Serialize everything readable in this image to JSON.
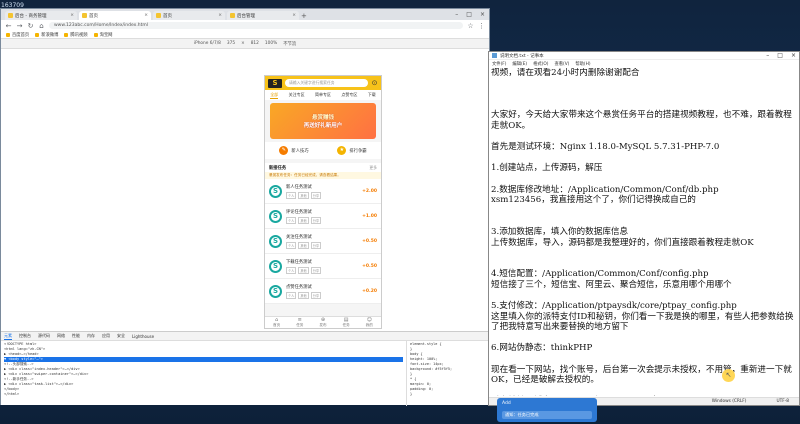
{
  "desktop": {
    "label": "163709"
  },
  "browser": {
    "tabs": [
      {
        "label": "后台 - 商务管理"
      },
      {
        "label": "首页"
      },
      {
        "label": "首页"
      },
      {
        "label": "后台管理"
      }
    ],
    "url": "www.123abc.com/Home/Index/index.html",
    "bookmarks": [
      "百度首页",
      "新浪微博",
      "腾讯视频",
      "淘宝网"
    ],
    "device": {
      "model": "iPhone 6/7/8",
      "width": "375",
      "height": "812",
      "zoom": "100%",
      "throttle": "不节流"
    }
  },
  "phone": {
    "search_placeholder": "请输入关键字进行搜索任务",
    "categories": [
      "全部",
      "关注专区",
      "简单专区",
      "点赞专区",
      "下载"
    ],
    "banner": {
      "line1": "悬赏赚钱",
      "line2": "再送好礼新用户"
    },
    "actions": [
      {
        "label": "新人技巧",
        "color": "#f57c00"
      },
      {
        "label": "排行争霸",
        "color": "#f4b400"
      }
    ],
    "task_header": {
      "title": "新接任务",
      "more": "更多"
    },
    "notice": "悬赏发布任务：任务已经完成，请查看结果。",
    "tasks": [
      {
        "name": "新人任务测试",
        "tags": [
          "个人",
          "其他",
          "分享"
        ],
        "reward": "+2.00"
      },
      {
        "name": "评论任务测试",
        "tags": [
          "个人",
          "其他",
          "分享"
        ],
        "reward": "+1.00"
      },
      {
        "name": "关注任务测试",
        "tags": [
          "个人",
          "其他",
          "分享"
        ],
        "reward": "+0.50"
      },
      {
        "name": "下载任务测试",
        "tags": [
          "个人",
          "其他",
          "分享"
        ],
        "reward": "+0.50"
      },
      {
        "name": "点赞任务测试",
        "tags": [
          "个人",
          "其他",
          "分享"
        ],
        "reward": "+0.20"
      }
    ],
    "nav": [
      "首页",
      "任务",
      "发布",
      "任务",
      "我的"
    ]
  },
  "devtools": {
    "tabs": [
      "元素",
      "控制台",
      "源代码",
      "网络",
      "性能",
      "内存",
      "应用",
      "安全",
      "Lighthouse"
    ],
    "dom_lines": [
      "<!DOCTYPE html>",
      "<html lang=\"zh-CN\">",
      "▶ <head>…</head>",
      "▼ <body style=\"…\">",
      "  <!--头部搜索-->",
      "  ▶ <div class=\"index-header\">…</div>",
      "  ▶ <div class=\"swiper-container\">…</div>",
      "  <!--新手任务-->",
      "  ▶ <div class=\"task-list\">…</div>",
      "</body>",
      "</html>"
    ],
    "styles_lines": [
      "element.style {",
      "}",
      "body {",
      "  height: 100%;",
      "  font-size: 14px;",
      "  background: #f5f5f5;",
      "}",
      "* {",
      "  margin: 0;",
      "  padding: 0;",
      "}"
    ]
  },
  "notepad": {
    "title": "说明文档.txt - 记事本",
    "menu": [
      "文件(F)",
      "编辑(E)",
      "格式(O)",
      "查看(V)",
      "帮助(H)"
    ],
    "text": "视频，请在观看24小时内删除谢谢配合\n\n\n\n大家好，今天给大家带来这个悬赏任务平台的搭建视频教程，也不难，跟着教程走就OK。\n\n首先是测试环境：Nginx 1.18.0-MySQL 5.7.31-PHP-7.0\n\n1.创建站点，上传源码，解压\n\n2.数据库修改地址：/Application/Common/Conf/db.php\nxsm123456，我直接用这个了，你们记得换成自己的\n\n\n3.添加数据库，填入你的数据库信息\n上传数据库，导入，源码都是我整理好的，你们直接跟着教程走就OK\n\n\n4.短信配置：/Application/Common/Conf/config.php\n短信接了三个，短信宝、阿里云、聚合短信，乐意用哪个用哪个\n\n5.支付修改：/Application/ptpaysdk/core/ptpay_config.php\n这里填入你的派特支付ID和秘钥，你们看一下我是换的哪里，有些人把参数给换了把我特意写出来要替换的地方留下\n\n6.网站伪静态：thinkPHP\n\n现在看一下网站，找个账号，后台第一次会提示未授权，不用管，重新进一下就OK，已经是破解去授权的。\n\n后台地址：域名/admin    账号：admin  密码：admin\n\n这个是带有用户发布任务功能的，信用分什么的，挺全面，具体的大家搭建出来",
    "status": [
      "Windows (CRLF)",
      "UTF-8"
    ]
  },
  "popup": {
    "title": "Add",
    "subtitle": "通知：任务已完成"
  }
}
